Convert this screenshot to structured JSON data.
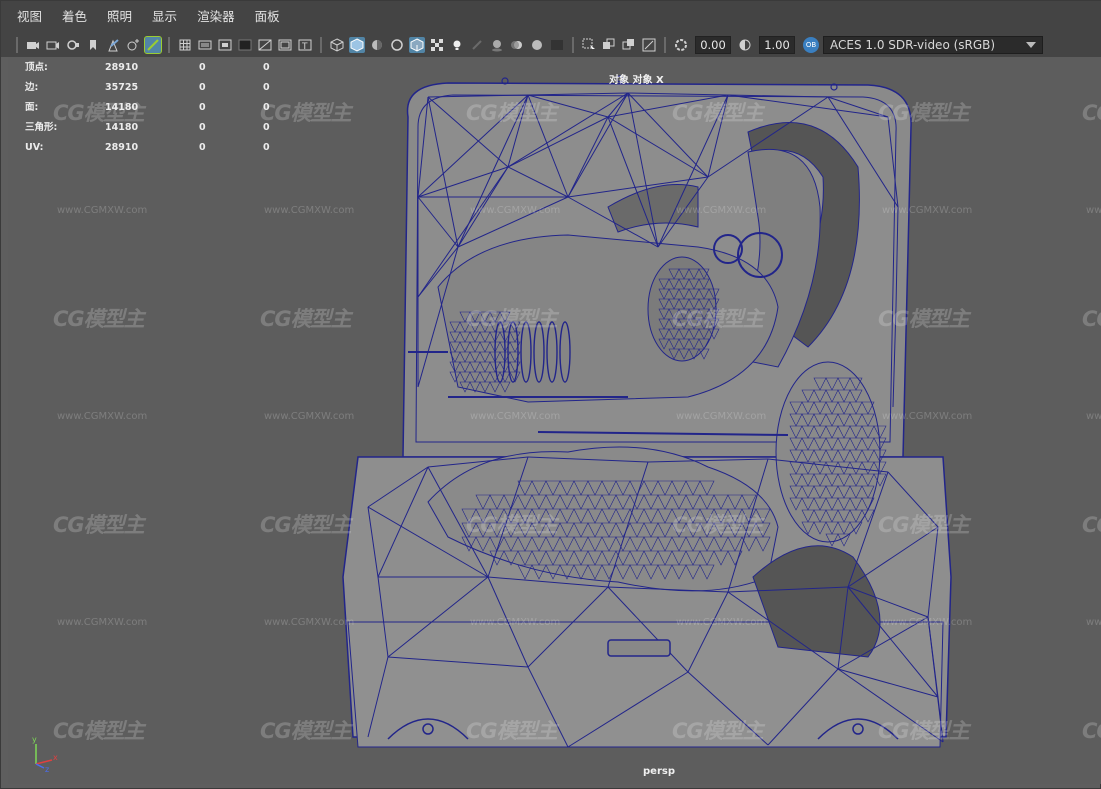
{
  "menubar": {
    "items": [
      "视图",
      "着色",
      "照明",
      "显示",
      "渲染器",
      "面板"
    ]
  },
  "toolbar": {
    "exposure": "0.00",
    "gamma": "1.00",
    "color_badge": "OB",
    "colorspace": "ACES 1.0 SDR-video (sRGB)"
  },
  "hud": {
    "rows": [
      {
        "label": "顶点:",
        "v1": "28910",
        "v2": "0",
        "v3": "0"
      },
      {
        "label": "边:",
        "v1": "35725",
        "v2": "0",
        "v3": "0"
      },
      {
        "label": "面:",
        "v1": "14180",
        "v2": "0",
        "v3": "0"
      },
      {
        "label": "三角形:",
        "v1": "14180",
        "v2": "0",
        "v3": "0"
      },
      {
        "label": "UV:",
        "v1": "28910",
        "v2": "0",
        "v3": "0"
      }
    ],
    "object_title": "对象 对象 X",
    "camera": "persp"
  },
  "watermark": {
    "logo": "CG模型主",
    "url": "www.CGMXW.com"
  },
  "axis": {
    "x": "x",
    "y": "y",
    "z": "z"
  },
  "colors": {
    "wire": "#22258a",
    "mesh_fill": "#8c8c8c",
    "viewport_bg": "#5d5d5d",
    "active_button": "#5285a6"
  }
}
